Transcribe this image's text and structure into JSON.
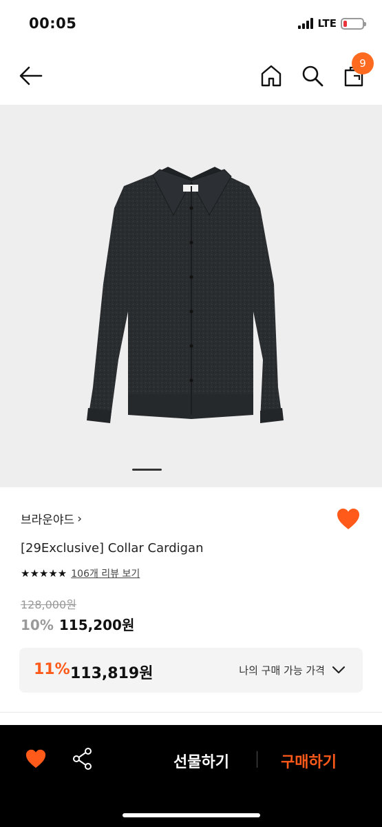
{
  "status_bar": {
    "time": "00:05",
    "network": "LTE"
  },
  "nav": {
    "icons": [
      "back-arrow-icon",
      "home-icon",
      "search-icon",
      "cart-icon"
    ],
    "cart_count": "9"
  },
  "product": {
    "carousel": {
      "current_index": 1
    },
    "brand": "브라운야드",
    "brand_chevron": "›",
    "name": "[29Exclusive] Collar Cardigan",
    "stars": "★★★★★",
    "rating": 5,
    "review_link": "106개 리뷰 보기",
    "original_price": "128,000원",
    "discount_percent": "10%",
    "sale_price": "115,200원",
    "best_price": {
      "percent": "11%",
      "price": "113,819원",
      "label": "나의 구매 가능 가격"
    }
  },
  "bottom_bar": {
    "gift_label": "선물하기",
    "buy_label": "구매하기"
  },
  "colors": {
    "accent": "#fe5a1a",
    "badge": "#fe6a1f",
    "image_background": "#eeeeee",
    "bottom_bar": "#000000"
  }
}
